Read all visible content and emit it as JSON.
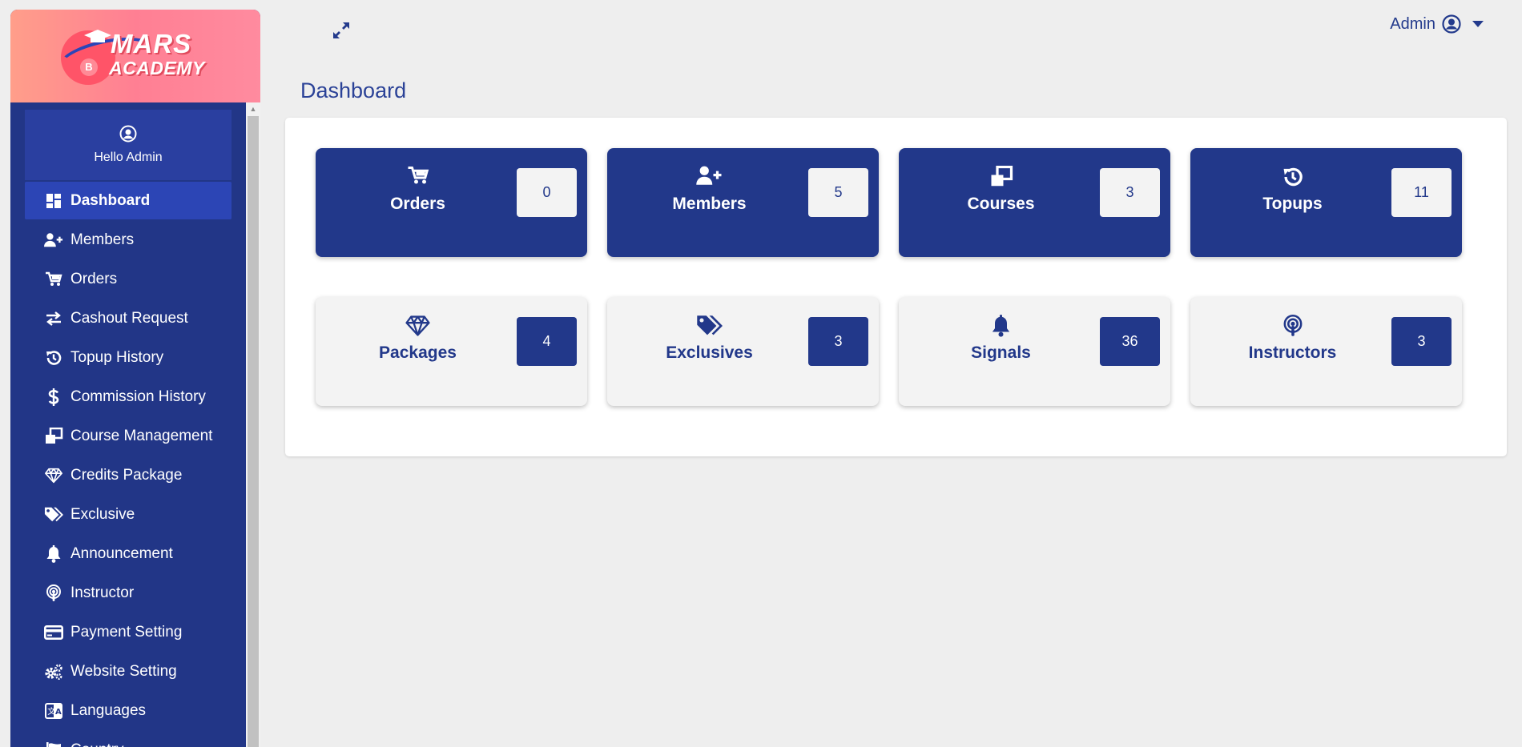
{
  "brand": {
    "line1": "MARS",
    "line2": "ACADEMY",
    "coin": "B"
  },
  "sidebar": {
    "greeting": "Hello Admin",
    "items": [
      {
        "label": "Dashboard",
        "icon": "dashboard-icon",
        "active": true
      },
      {
        "label": "Members",
        "icon": "user-plus-icon"
      },
      {
        "label": "Orders",
        "icon": "cart-icon"
      },
      {
        "label": "Cashout Request",
        "icon": "exchange-icon"
      },
      {
        "label": "Topup History",
        "icon": "history-icon"
      },
      {
        "label": "Commission History",
        "icon": "dollar-icon"
      },
      {
        "label": "Course Management",
        "icon": "clone-icon"
      },
      {
        "label": "Credits Package",
        "icon": "gem-icon"
      },
      {
        "label": "Exclusive",
        "icon": "tags-icon"
      },
      {
        "label": "Announcement",
        "icon": "bell-icon"
      },
      {
        "label": "Instructor",
        "icon": "podcast-icon"
      },
      {
        "label": "Payment Setting",
        "icon": "credit-card-icon"
      },
      {
        "label": "Website Setting",
        "icon": "cogs-icon"
      },
      {
        "label": "Languages",
        "icon": "language-icon"
      },
      {
        "label": "Country",
        "icon": "flag-icon"
      }
    ]
  },
  "header": {
    "user_label": "Admin"
  },
  "page": {
    "title": "Dashboard"
  },
  "cards": [
    {
      "label": "Orders",
      "count": "0",
      "icon": "cart-icon",
      "style": "dark"
    },
    {
      "label": "Members",
      "count": "5",
      "icon": "user-plus-icon",
      "style": "dark"
    },
    {
      "label": "Courses",
      "count": "3",
      "icon": "clone-icon",
      "style": "dark"
    },
    {
      "label": "Topups",
      "count": "11",
      "icon": "history-icon",
      "style": "dark"
    },
    {
      "label": "Packages",
      "count": "4",
      "icon": "gem-icon",
      "style": "light"
    },
    {
      "label": "Exclusives",
      "count": "3",
      "icon": "tags-icon",
      "style": "light"
    },
    {
      "label": "Signals",
      "count": "36",
      "icon": "bell-icon",
      "style": "light"
    },
    {
      "label": "Instructors",
      "count": "3",
      "icon": "podcast-icon",
      "style": "light"
    }
  ],
  "colors": {
    "primary": "#22388a",
    "active": "#2c45b5",
    "logo_bg": "#ff8a96",
    "card_light": "#f3f3f3"
  }
}
